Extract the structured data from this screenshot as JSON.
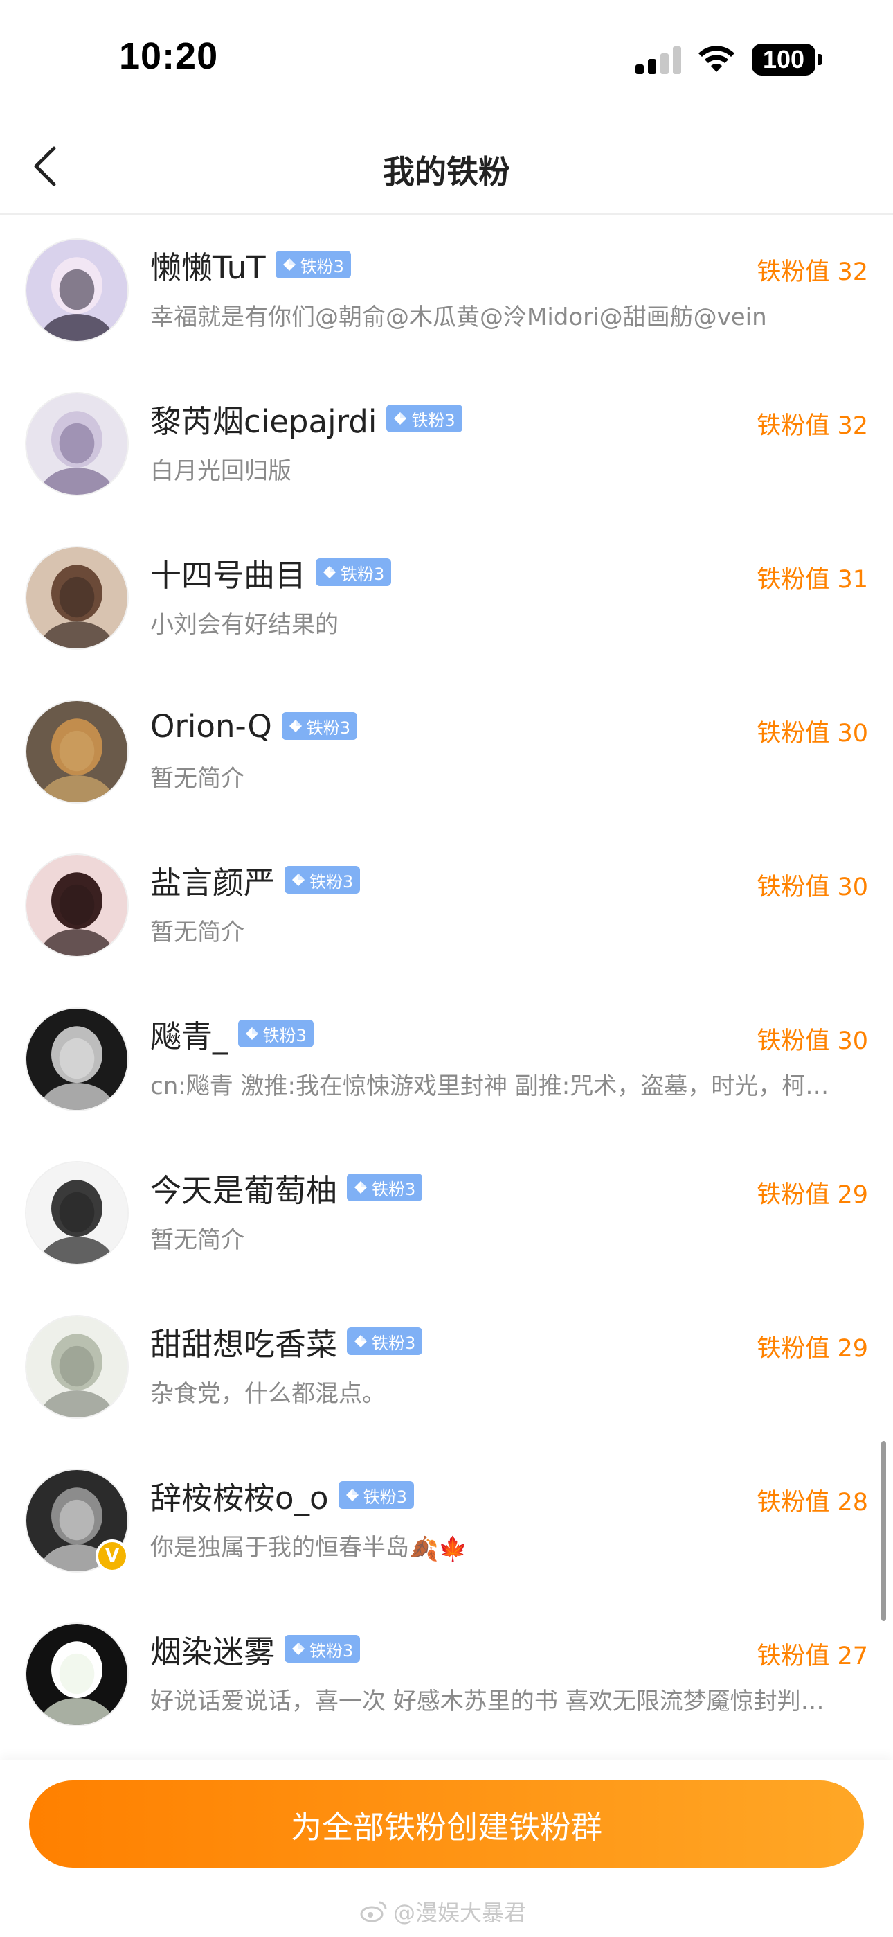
{
  "status_bar": {
    "time": "10:20",
    "battery": "100"
  },
  "nav": {
    "title": "我的铁粉"
  },
  "badge_label": "铁粉3",
  "fans": [
    {
      "name": "懒懒TuT",
      "badge": "铁粉3",
      "score": "铁粉值 32",
      "bio": "幸福就是有你们@朝俞@木瓜黄@泠Midori@甜画舫@vein",
      "verified": false
    },
    {
      "name": "黎芮烟ciepajrdi",
      "badge": "铁粉3",
      "score": "铁粉值 32",
      "bio": "白月光回归版",
      "verified": false
    },
    {
      "name": "十四号曲目",
      "badge": "铁粉3",
      "score": "铁粉值 31",
      "bio": "小刘会有好结果的",
      "verified": false
    },
    {
      "name": "Orion-Q",
      "badge": "铁粉3",
      "score": "铁粉值 30",
      "bio": "暂无简介",
      "verified": false
    },
    {
      "name": "盐言颜严",
      "badge": "铁粉3",
      "score": "铁粉值 30",
      "bio": "暂无简介",
      "verified": false
    },
    {
      "name": "飚青_",
      "badge": "铁粉3",
      "score": "铁粉值 30",
      "bio": "cn:飚青 激推:我在惊悚游戏里封神 副推:咒术，盗墓，时光，柯…",
      "verified": false
    },
    {
      "name": "今天是葡萄柚",
      "badge": "铁粉3",
      "score": "铁粉值 29",
      "bio": "暂无简介",
      "verified": false
    },
    {
      "name": "甜甜想吃香菜",
      "badge": "铁粉3",
      "score": "铁粉值 29",
      "bio": "杂食党，什么都混点。",
      "verified": false
    },
    {
      "name": "辞桉桉桉o_o",
      "badge": "铁粉3",
      "score": "铁粉值 28",
      "bio": "你是独属于我的恒春半岛",
      "bio_emoji": "🍂🍁",
      "verified": true
    },
    {
      "name": "烟染迷雾",
      "badge": "铁粉3",
      "score": "铁粉值 27",
      "bio": "好说话爱说话，喜一次 好感木苏里的书 喜欢无限流梦魇惊封判…",
      "verified": false
    }
  ],
  "bottom": {
    "button_label": "为全部铁粉创建铁粉群",
    "watermark": "@漫娱大暴君"
  },
  "icons": {
    "back": "chevron-left-icon",
    "badge_gem": "diamond-icon",
    "verified": "verified-v-icon",
    "weibo": "weibo-logo-icon"
  },
  "colors": {
    "accent_orange": "#ff8200",
    "badge_blue": "#7fb0f5",
    "bio_gray": "#8a8a8a",
    "button_gradient_start": "#ff8000",
    "button_gradient_end": "#ffa726"
  }
}
